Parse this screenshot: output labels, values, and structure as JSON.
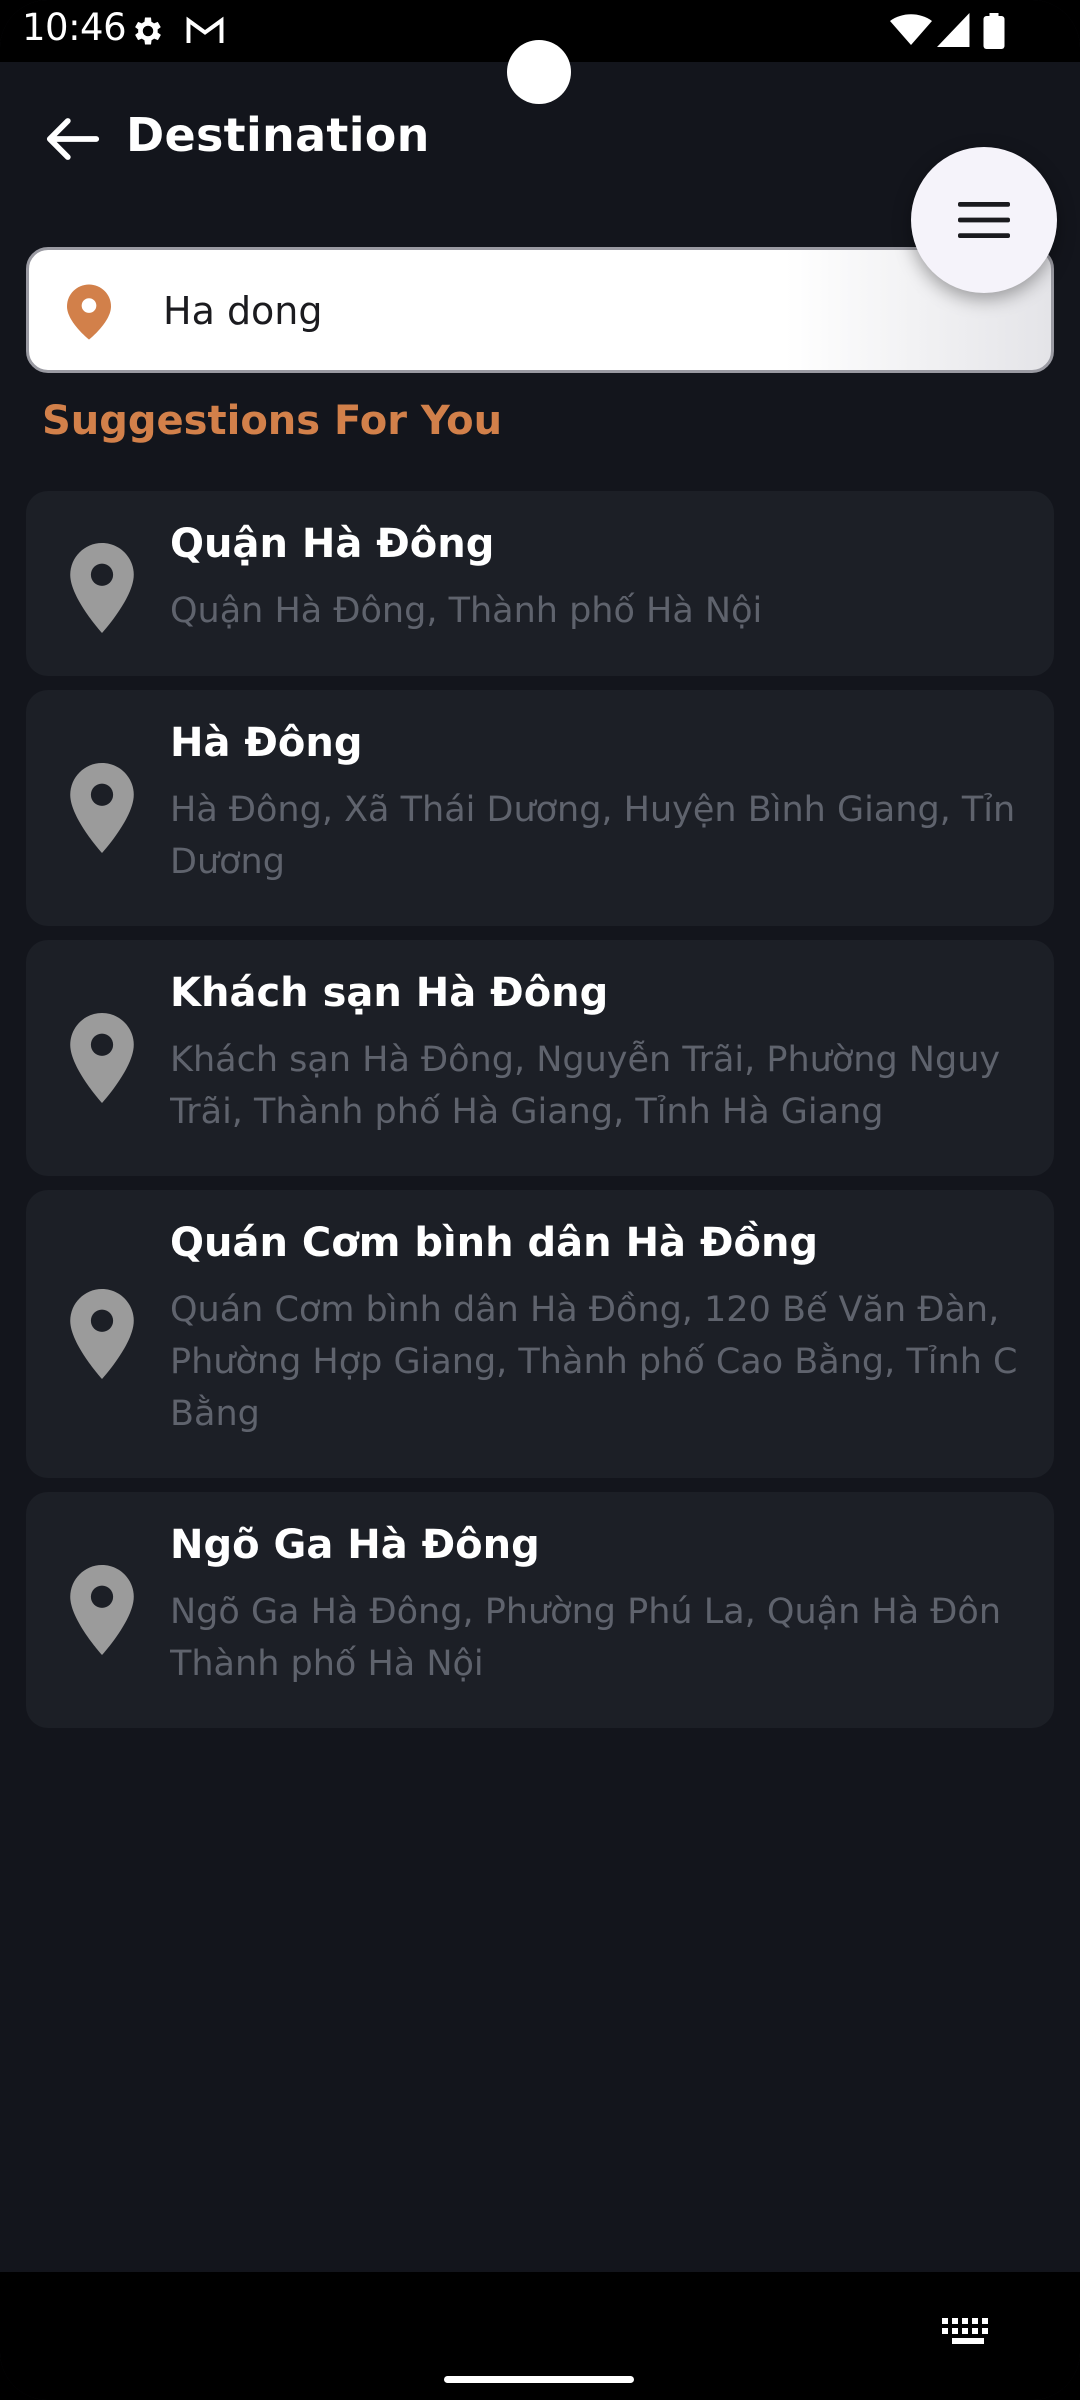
{
  "status_bar": {
    "time": "10:46",
    "icons": [
      "settings-icon",
      "gmail-icon",
      "wifi-icon",
      "signal-icon",
      "battery-icon"
    ]
  },
  "header": {
    "title": "Destination",
    "back_icon": "arrow-left-icon",
    "menu_icon": "hamburger-menu-icon"
  },
  "search": {
    "value": "Ha dong",
    "icon": "location-pin-icon",
    "pin_color": "#d2804a"
  },
  "suggestions": {
    "title": "Suggestions For You",
    "items": [
      {
        "title": "Quận Hà Đông",
        "subtitle": "Quận Hà Đông, Thành phố Hà Nội"
      },
      {
        "title": "Hà Đông",
        "subtitle": "Hà Đông, Xã Thái Dương, Huyện Bình Giang, Tỉn\nDương"
      },
      {
        "title": "Khách sạn Hà Đông",
        "subtitle": "Khách sạn Hà Đông, Nguyễn Trãi, Phường Nguy\nTrãi, Thành phố Hà Giang, Tỉnh Hà Giang"
      },
      {
        "title": "Quán Cơm bình dân Hà Đồng",
        "subtitle": "Quán Cơm bình dân Hà Đồng, 120 Bế Văn Đàn,\nPhường Hợp Giang, Thành phố Cao Bằng, Tỉnh C\nBằng"
      },
      {
        "title": "Ngõ Ga Hà Đông",
        "subtitle": "Ngõ Ga Hà Đông, Phường Phú La, Quận Hà Đôn\nThành phố Hà Nội"
      }
    ]
  },
  "nav_bar": {
    "keyboard_icon": "keyboard-icon"
  },
  "colors": {
    "background": "#13151c",
    "card": "#1c1f26",
    "accent": "#d2804a",
    "subtitle": "#5f636d",
    "pin_gray": "#9b9b9b"
  }
}
